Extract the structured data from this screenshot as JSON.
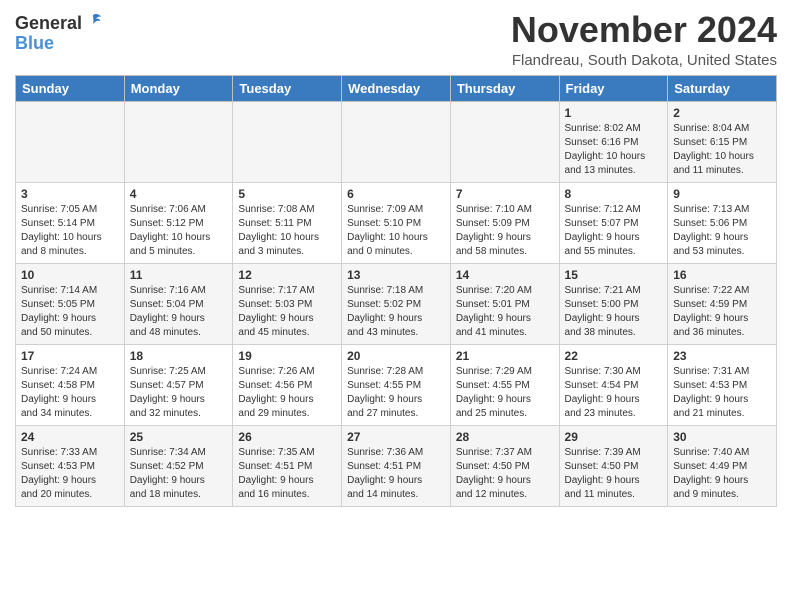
{
  "header": {
    "logo_general": "General",
    "logo_blue": "Blue",
    "month_title": "November 2024",
    "location": "Flandreau, South Dakota, United States"
  },
  "weekdays": [
    "Sunday",
    "Monday",
    "Tuesday",
    "Wednesday",
    "Thursday",
    "Friday",
    "Saturday"
  ],
  "weeks": [
    [
      {
        "day": "",
        "info": ""
      },
      {
        "day": "",
        "info": ""
      },
      {
        "day": "",
        "info": ""
      },
      {
        "day": "",
        "info": ""
      },
      {
        "day": "",
        "info": ""
      },
      {
        "day": "1",
        "info": "Sunrise: 8:02 AM\nSunset: 6:16 PM\nDaylight: 10 hours\nand 13 minutes."
      },
      {
        "day": "2",
        "info": "Sunrise: 8:04 AM\nSunset: 6:15 PM\nDaylight: 10 hours\nand 11 minutes."
      }
    ],
    [
      {
        "day": "3",
        "info": "Sunrise: 7:05 AM\nSunset: 5:14 PM\nDaylight: 10 hours\nand 8 minutes."
      },
      {
        "day": "4",
        "info": "Sunrise: 7:06 AM\nSunset: 5:12 PM\nDaylight: 10 hours\nand 5 minutes."
      },
      {
        "day": "5",
        "info": "Sunrise: 7:08 AM\nSunset: 5:11 PM\nDaylight: 10 hours\nand 3 minutes."
      },
      {
        "day": "6",
        "info": "Sunrise: 7:09 AM\nSunset: 5:10 PM\nDaylight: 10 hours\nand 0 minutes."
      },
      {
        "day": "7",
        "info": "Sunrise: 7:10 AM\nSunset: 5:09 PM\nDaylight: 9 hours\nand 58 minutes."
      },
      {
        "day": "8",
        "info": "Sunrise: 7:12 AM\nSunset: 5:07 PM\nDaylight: 9 hours\nand 55 minutes."
      },
      {
        "day": "9",
        "info": "Sunrise: 7:13 AM\nSunset: 5:06 PM\nDaylight: 9 hours\nand 53 minutes."
      }
    ],
    [
      {
        "day": "10",
        "info": "Sunrise: 7:14 AM\nSunset: 5:05 PM\nDaylight: 9 hours\nand 50 minutes."
      },
      {
        "day": "11",
        "info": "Sunrise: 7:16 AM\nSunset: 5:04 PM\nDaylight: 9 hours\nand 48 minutes."
      },
      {
        "day": "12",
        "info": "Sunrise: 7:17 AM\nSunset: 5:03 PM\nDaylight: 9 hours\nand 45 minutes."
      },
      {
        "day": "13",
        "info": "Sunrise: 7:18 AM\nSunset: 5:02 PM\nDaylight: 9 hours\nand 43 minutes."
      },
      {
        "day": "14",
        "info": "Sunrise: 7:20 AM\nSunset: 5:01 PM\nDaylight: 9 hours\nand 41 minutes."
      },
      {
        "day": "15",
        "info": "Sunrise: 7:21 AM\nSunset: 5:00 PM\nDaylight: 9 hours\nand 38 minutes."
      },
      {
        "day": "16",
        "info": "Sunrise: 7:22 AM\nSunset: 4:59 PM\nDaylight: 9 hours\nand 36 minutes."
      }
    ],
    [
      {
        "day": "17",
        "info": "Sunrise: 7:24 AM\nSunset: 4:58 PM\nDaylight: 9 hours\nand 34 minutes."
      },
      {
        "day": "18",
        "info": "Sunrise: 7:25 AM\nSunset: 4:57 PM\nDaylight: 9 hours\nand 32 minutes."
      },
      {
        "day": "19",
        "info": "Sunrise: 7:26 AM\nSunset: 4:56 PM\nDaylight: 9 hours\nand 29 minutes."
      },
      {
        "day": "20",
        "info": "Sunrise: 7:28 AM\nSunset: 4:55 PM\nDaylight: 9 hours\nand 27 minutes."
      },
      {
        "day": "21",
        "info": "Sunrise: 7:29 AM\nSunset: 4:55 PM\nDaylight: 9 hours\nand 25 minutes."
      },
      {
        "day": "22",
        "info": "Sunrise: 7:30 AM\nSunset: 4:54 PM\nDaylight: 9 hours\nand 23 minutes."
      },
      {
        "day": "23",
        "info": "Sunrise: 7:31 AM\nSunset: 4:53 PM\nDaylight: 9 hours\nand 21 minutes."
      }
    ],
    [
      {
        "day": "24",
        "info": "Sunrise: 7:33 AM\nSunset: 4:53 PM\nDaylight: 9 hours\nand 20 minutes."
      },
      {
        "day": "25",
        "info": "Sunrise: 7:34 AM\nSunset: 4:52 PM\nDaylight: 9 hours\nand 18 minutes."
      },
      {
        "day": "26",
        "info": "Sunrise: 7:35 AM\nSunset: 4:51 PM\nDaylight: 9 hours\nand 16 minutes."
      },
      {
        "day": "27",
        "info": "Sunrise: 7:36 AM\nSunset: 4:51 PM\nDaylight: 9 hours\nand 14 minutes."
      },
      {
        "day": "28",
        "info": "Sunrise: 7:37 AM\nSunset: 4:50 PM\nDaylight: 9 hours\nand 12 minutes."
      },
      {
        "day": "29",
        "info": "Sunrise: 7:39 AM\nSunset: 4:50 PM\nDaylight: 9 hours\nand 11 minutes."
      },
      {
        "day": "30",
        "info": "Sunrise: 7:40 AM\nSunset: 4:49 PM\nDaylight: 9 hours\nand 9 minutes."
      }
    ]
  ]
}
